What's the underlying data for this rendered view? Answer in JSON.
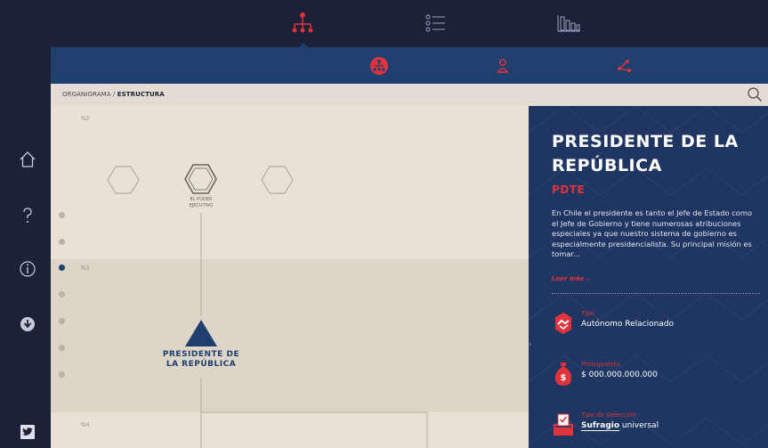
{
  "colors": {
    "dark": "#1b2138",
    "navy": "#1f3f6e",
    "panel": "#1f3663",
    "accent": "#e0333c",
    "canvas": "#e8e1d6"
  },
  "topbar": {
    "icons": [
      "org-chart-icon",
      "list-icon",
      "bar-chart-icon"
    ],
    "active": "org-chart-icon"
  },
  "subbar": {
    "icons": [
      "org-structure-icon",
      "person-icon",
      "share-icon"
    ],
    "active": "org-structure-icon"
  },
  "sidebar": {
    "icons": [
      "home-icon",
      "help-icon",
      "info-icon",
      "download-icon",
      "twitter-icon"
    ]
  },
  "breadcrumb": {
    "root": "ORGANIGRAMA /",
    "current": "ESTRUCTURA"
  },
  "canvas": {
    "levels": [
      "N2",
      "N3",
      "N4"
    ],
    "active_level": "N3",
    "node_label": "EL PODER\nEJECUTIVO",
    "president_label": "PRESIDENTE DE\nLA REPÚBLICA"
  },
  "panel": {
    "title": "PRESIDENTE DE LA REPÚBLICA",
    "abbr": "PDTE",
    "description": "En Chile el presidente es tanto el Jefe de Estado como el Jefe de Gobierno y tiene numerosas atribuciones especiales ya que nuestro sistema de gobierno es especialmente presidencialista. Su principal misión es tomar...",
    "read_more": "Leer más ⌄",
    "tipo_label": "Tipo",
    "tipo_value": "Autónomo Relacionado",
    "presupuesto_label": "Presupuesto",
    "presupuesto_value": "$ 000.000.000.000",
    "seleccion_label": "Tipo de Selección",
    "seleccion_bold": "Sufragio",
    "seleccion_rest": " universal"
  }
}
